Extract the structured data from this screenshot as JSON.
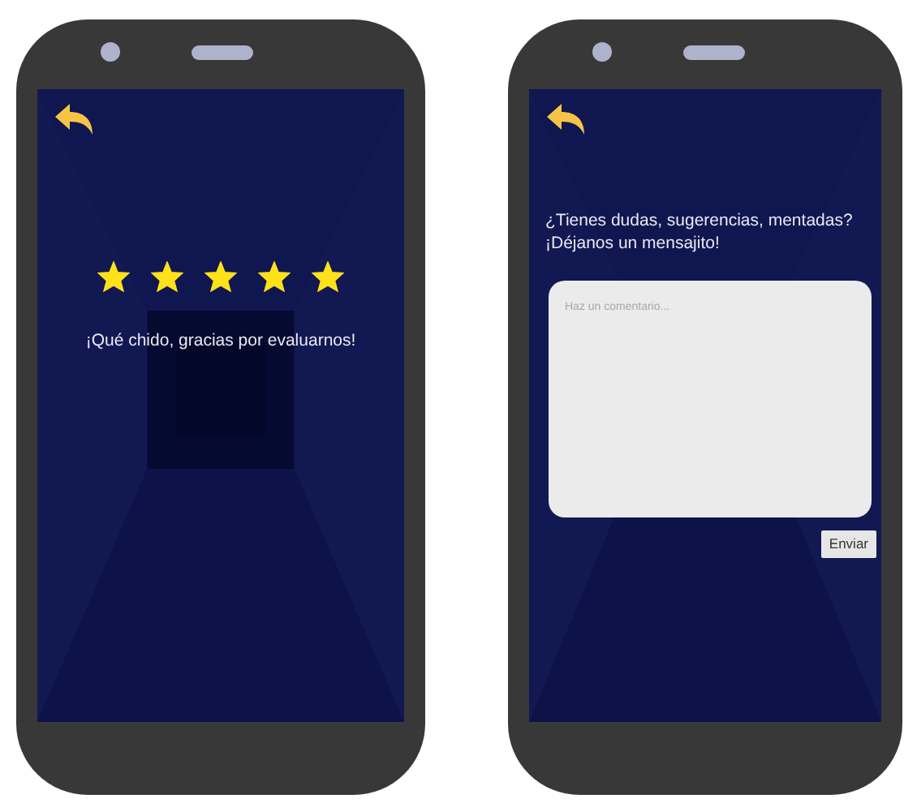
{
  "screens": [
    {
      "kind": "rating",
      "stars": 5,
      "message": "¡Qué chido, gracias por evaluarnos!"
    },
    {
      "kind": "feedback",
      "prompt": "¿Tienes dudas, sugerencias, mentadas?\n¡Déjanos un mensajito!",
      "comment": {
        "placeholder": "Haz un comentario..."
      },
      "button": "Enviar"
    }
  ]
}
